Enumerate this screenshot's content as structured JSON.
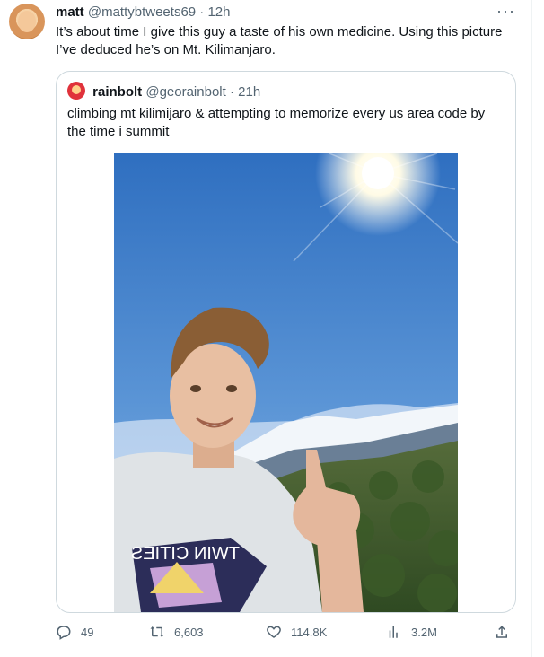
{
  "tweet": {
    "author_name": "matt",
    "handle": "@mattybtweets69",
    "separator": " · ",
    "time": "12h",
    "more": "···",
    "text": "It’s about time I give this guy a taste of his own medicine. Using this picture I’ve deduced he’s on Mt. Kilimanjaro."
  },
  "quote": {
    "author_name": "rainbolt",
    "handle": "@georainbolt",
    "separator": " · ",
    "time": "21h",
    "text": "climbing mt kilimijaro & attempting to memorize every us area code by the time i summit",
    "photo_text": "TWIN CITIES"
  },
  "actions": {
    "replies": "49",
    "retweets": "6,603",
    "likes": "114.8K",
    "views": "3.2M"
  },
  "icons": {
    "reply": "reply-icon",
    "retweet": "retweet-icon",
    "like": "heart-icon",
    "views": "analytics-icon",
    "share": "share-icon"
  },
  "colors": {
    "text": "#0f1419",
    "muted": "#536471",
    "border": "#cfd9de",
    "sky": "#3e79c4"
  }
}
